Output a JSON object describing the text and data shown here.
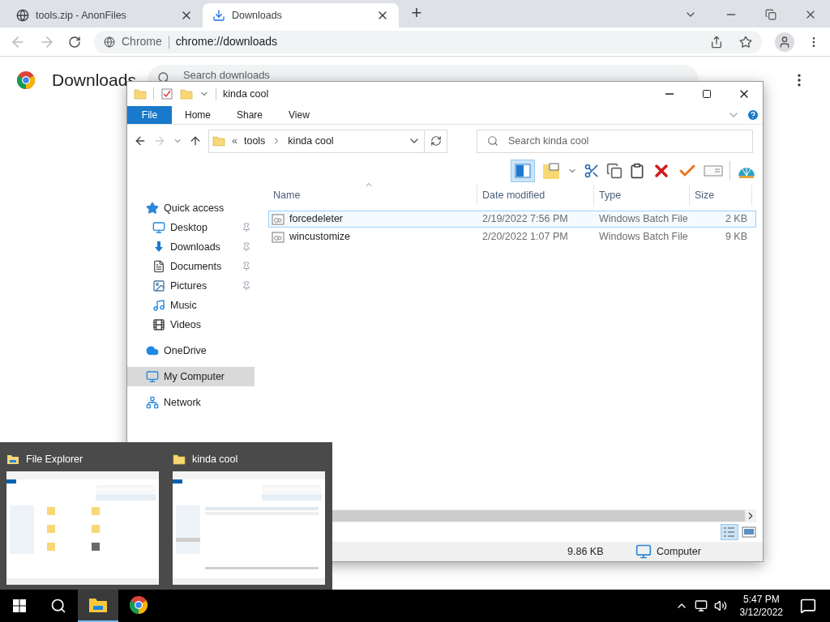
{
  "browser": {
    "tabs": [
      {
        "title": "tools.zip - AnonFiles",
        "selected": false,
        "kind": "globe"
      },
      {
        "title": "Downloads",
        "selected": true,
        "kind": "download"
      }
    ],
    "new_tab": "+",
    "omnibox": {
      "chip": "Chrome",
      "url": "chrome://downloads"
    },
    "page": {
      "heading": "Downloads",
      "search_placeholder": "Search downloads"
    }
  },
  "explorer": {
    "title": "kinda cool",
    "ribbon_tabs": [
      {
        "label": "File",
        "kind": "file",
        "selected": false
      },
      {
        "label": "Home",
        "kind": "tab",
        "selected": false
      },
      {
        "label": "Share",
        "kind": "tab",
        "selected": false
      },
      {
        "label": "View",
        "kind": "tab",
        "selected": false
      }
    ],
    "address": {
      "overflow": "«",
      "crumbs": [
        "tools",
        "kinda cool"
      ]
    },
    "search_placeholder": "Search kinda cool",
    "nav": [
      {
        "label": "Quick access",
        "kind": "star",
        "selected": false,
        "children": [
          {
            "label": "Desktop",
            "kind": "desktop",
            "pinned": true,
            "selected": false
          },
          {
            "label": "Downloads",
            "kind": "download",
            "pinned": true,
            "selected": false
          },
          {
            "label": "Documents",
            "kind": "document",
            "pinned": true,
            "selected": false
          },
          {
            "label": "Pictures",
            "kind": "pictures",
            "pinned": true,
            "selected": false
          },
          {
            "label": "Music",
            "kind": "music",
            "pinned": false,
            "selected": false
          },
          {
            "label": "Videos",
            "kind": "video",
            "pinned": false,
            "selected": false
          }
        ]
      },
      {
        "label": "OneDrive",
        "kind": "cloud",
        "selected": false
      },
      {
        "label": "My Computer",
        "kind": "computer",
        "selected": true
      },
      {
        "label": "Network",
        "kind": "network",
        "selected": false
      }
    ],
    "columns": [
      "Name",
      "Date modified",
      "Type",
      "Size"
    ],
    "rows": [
      {
        "name": "forcedeleter",
        "date": "2/19/2022 7:56 PM",
        "type": "Windows Batch File",
        "size": "2 KB",
        "selected": true
      },
      {
        "name": "wincustomize",
        "date": "2/20/2022 1:07 PM",
        "type": "Windows Batch File",
        "size": "9 KB",
        "selected": false
      }
    ],
    "status": {
      "size": "9.86 KB",
      "location": "Computer"
    }
  },
  "previews": [
    {
      "title": "File Explorer",
      "kind": "explorer"
    },
    {
      "title": "kinda cool",
      "kind": "folder"
    }
  ],
  "taskbar": {
    "apps": [
      {
        "kind": "explorer",
        "active": true
      },
      {
        "kind": "chrome",
        "active": false
      }
    ],
    "time": "5:47 PM",
    "date": "3/12/2022"
  }
}
